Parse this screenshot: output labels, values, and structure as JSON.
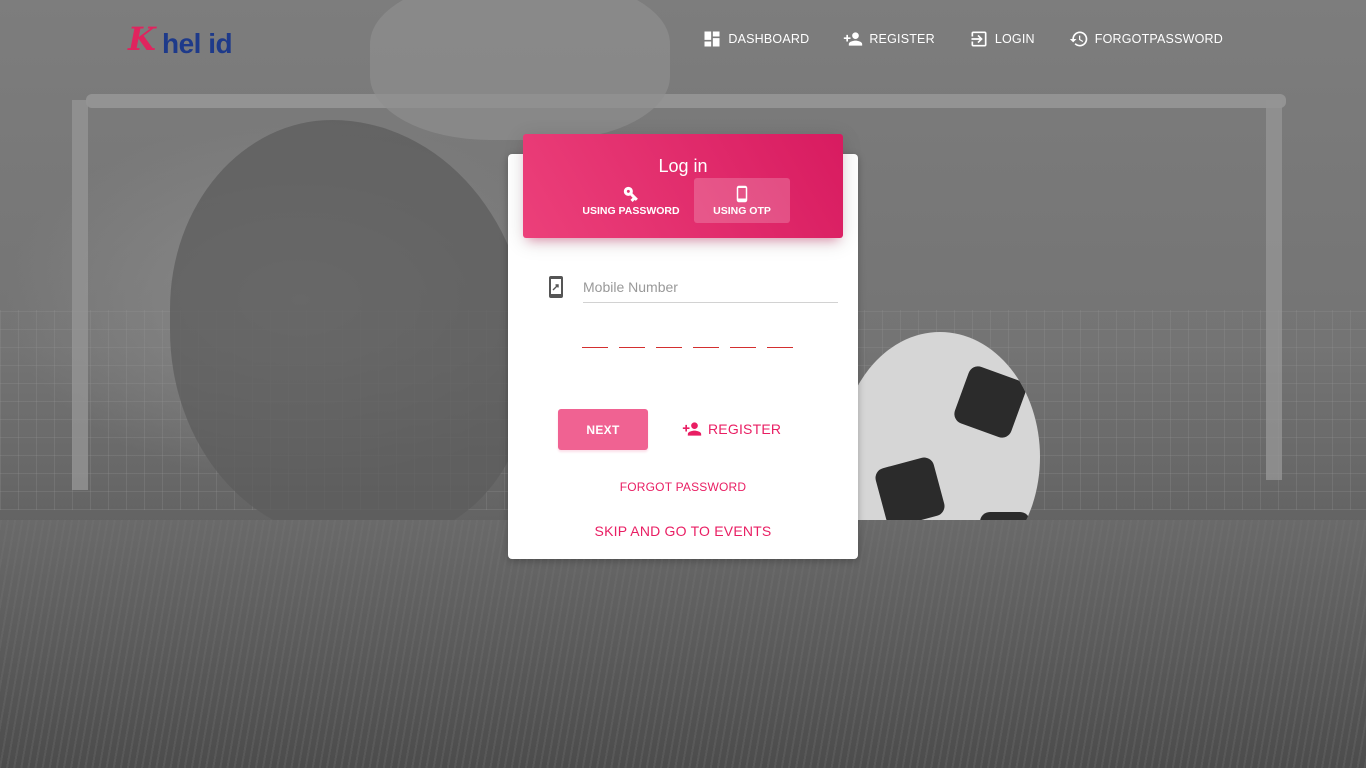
{
  "brand": {
    "logo_text": "Khel id",
    "mark": "K",
    "word": "hel id"
  },
  "nav": {
    "items": [
      {
        "label": "DASHBOARD",
        "icon": "dashboard-icon"
      },
      {
        "label": "REGISTER",
        "icon": "person-add-icon"
      },
      {
        "label": "LOGIN",
        "icon": "login-icon"
      },
      {
        "label": "FORGOTPASSWORD",
        "icon": "history-icon"
      }
    ]
  },
  "login": {
    "title": "Log in",
    "tabs": [
      {
        "label": "USING PASSWORD",
        "icon": "key-icon",
        "active": false
      },
      {
        "label": "USING OTP",
        "icon": "phone-icon",
        "active": true
      }
    ],
    "mobile_placeholder": "Mobile Number",
    "mobile_value": "",
    "otp_digits": [
      "",
      "",
      "",
      "",
      "",
      ""
    ],
    "next_label": "NEXT",
    "register_label": "REGISTER",
    "forgot_label": "FORGOT PASSWORD",
    "skip_label": "SKIP AND GO TO EVENTS"
  },
  "colors": {
    "accent": "#e91e63",
    "header_gradient_start": "#ec407a",
    "header_gradient_end": "#d81b60",
    "next_button": "#f06292",
    "otp_underline": "#d32f2f"
  }
}
